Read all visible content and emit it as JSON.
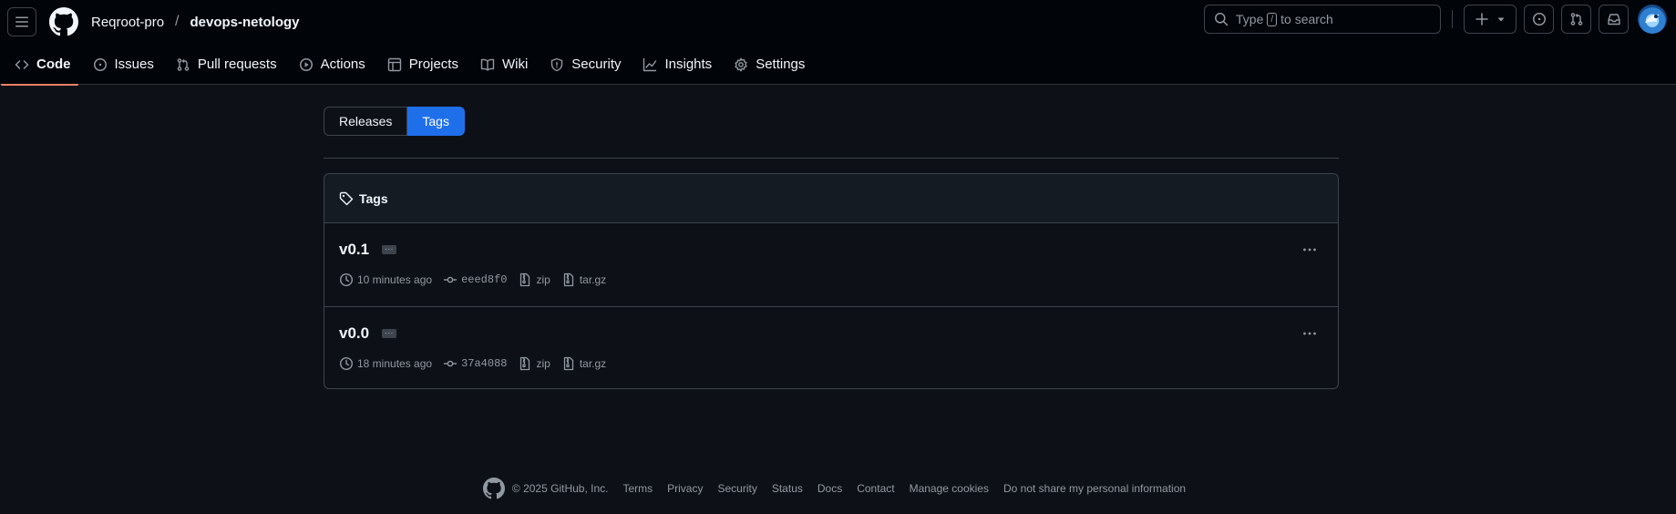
{
  "header": {
    "owner": "Reqroot-pro",
    "separator": "/",
    "repo": "devops-netology",
    "search": {
      "prefix": "Type",
      "key": "/",
      "suffix": "to search"
    }
  },
  "tabs": [
    {
      "label": "Code",
      "icon": "code-icon"
    },
    {
      "label": "Issues",
      "icon": "issue-opened-icon"
    },
    {
      "label": "Pull requests",
      "icon": "git-pull-request-icon"
    },
    {
      "label": "Actions",
      "icon": "play-icon"
    },
    {
      "label": "Projects",
      "icon": "table-icon"
    },
    {
      "label": "Wiki",
      "icon": "book-icon"
    },
    {
      "label": "Security",
      "icon": "shield-icon"
    },
    {
      "label": "Insights",
      "icon": "graph-icon"
    },
    {
      "label": "Settings",
      "icon": "gear-icon"
    }
  ],
  "selected_tab": "Code",
  "segmented": {
    "releases": "Releases",
    "tags": "Tags",
    "active": "Tags"
  },
  "tags_box": {
    "title": "Tags",
    "items": [
      {
        "name": "v0.1",
        "time": "10 minutes ago",
        "sha": "eeed8f0",
        "zip": "zip",
        "targz": "tar.gz"
      },
      {
        "name": "v0.0",
        "time": "18 minutes ago",
        "sha": "37a4088",
        "zip": "zip",
        "targz": "tar.gz"
      }
    ]
  },
  "footer": {
    "copyright": "© 2025 GitHub, Inc.",
    "links": [
      "Terms",
      "Privacy",
      "Security",
      "Status",
      "Docs",
      "Contact",
      "Manage cookies",
      "Do not share my personal information"
    ]
  },
  "colors": {
    "background": "#0d1117",
    "header_bg": "#010409",
    "accent_blue": "#1f6feb",
    "selected_underline": "#f78166",
    "border": "#3d444d",
    "muted_text": "#9198a1"
  }
}
